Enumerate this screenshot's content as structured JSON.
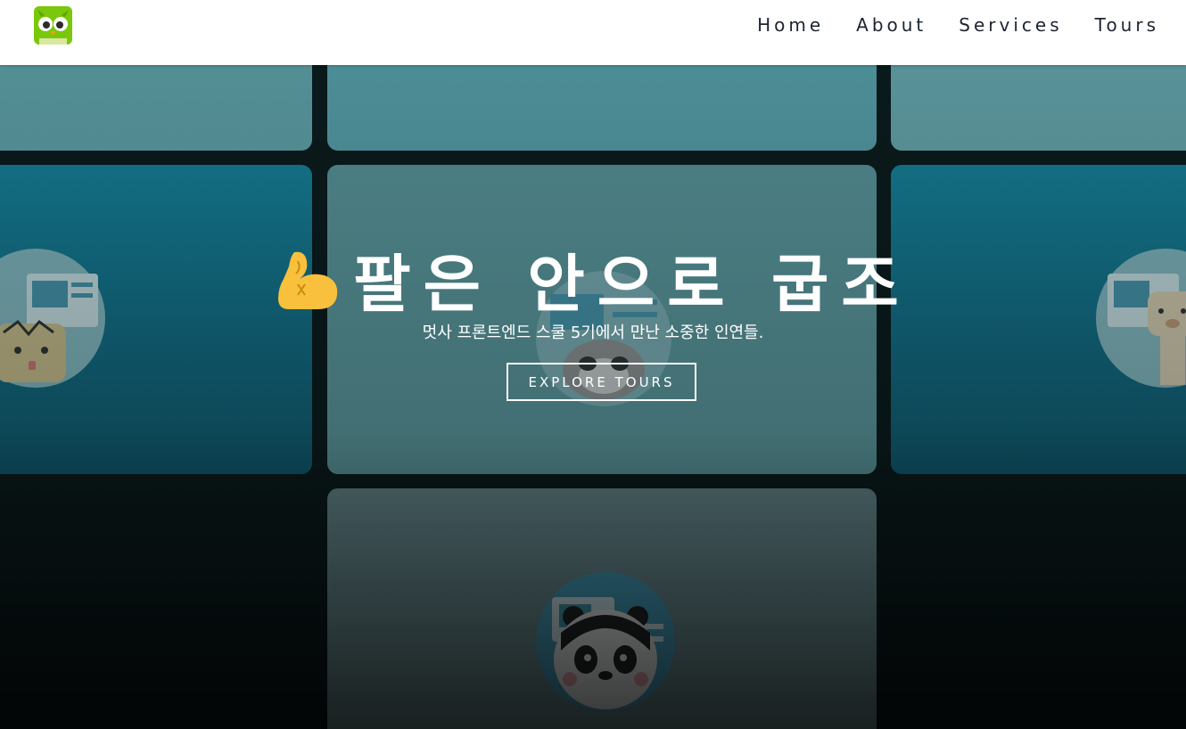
{
  "nav": {
    "logo_icon": "duolingo-owl-icon",
    "links": [
      "Home",
      "About",
      "Services",
      "Tours"
    ]
  },
  "hero": {
    "emoji_icon": "flexed-biceps-icon",
    "headline": "팔은 안으로 굽조",
    "subtitle": "멋사 프론트엔드 스쿨 5기에서 만난 소중한 인연들.",
    "cta_label": "EXPLORE TOURS"
  },
  "colors": {
    "nav_bg": "#ffffff",
    "nav_text": "#1b2430",
    "logo_green": "#78c800",
    "card_teal": "#178aa6",
    "hero_text": "#ffffff"
  }
}
